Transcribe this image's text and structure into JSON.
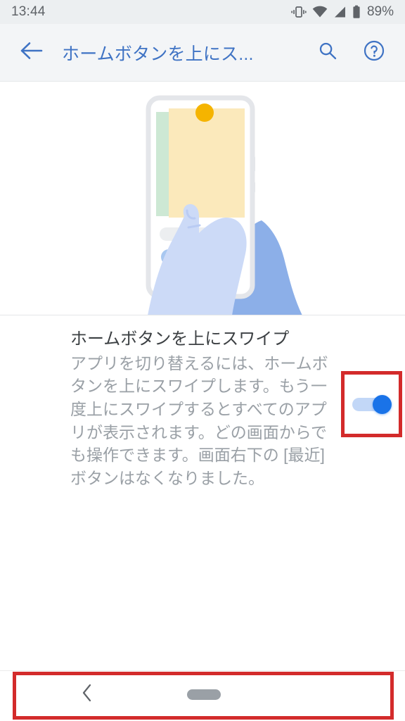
{
  "status_bar": {
    "time": "13:44",
    "battery_percent": "89%",
    "icons": [
      "vibrate-icon",
      "wifi-icon",
      "cell-signal-icon",
      "battery-icon"
    ]
  },
  "app_bar": {
    "back_label": "back-arrow",
    "title": "ホームボタンを上にス...",
    "search_label": "search-icon",
    "help_label": "help-icon",
    "title_color": "#3f73c4"
  },
  "illustration": {
    "name": "swipe-up-home-button-illustration",
    "phone_screen_colors": {
      "card_back": "#cde8d4",
      "card_front": "#fbe9bb",
      "dot": "#f5b400",
      "hand": "#ccdaf7",
      "sleeve": "#8cafe8",
      "home_pill": "#1a73e8"
    },
    "app_dots": [
      "#a8c7f0",
      "#b7ddb4",
      "#f8d77e",
      "#f3a9a0"
    ]
  },
  "setting": {
    "title": "ホームボタンを上にスワイプ",
    "description": "アプリを切り替えるには、ホームボタンを上にスワイプします。もう一度上にスワイプするとすべてのアプリが表示されます。どの画面からでも操作できます。画面右下の [最近] ボタンはなくなりました。",
    "toggle": {
      "name": "swipe-up-home-button-switch",
      "state": "on",
      "track_color": "#c2d7f7",
      "thumb_color": "#1a73e8"
    }
  },
  "annotations": {
    "highlight_color": "#d32b2b",
    "boxes": [
      "toggle-highlight-box",
      "navigation-bar-highlight-box"
    ]
  },
  "navigation_bar": {
    "back_label": "nav-back-chevron",
    "home_label": "nav-home-pill",
    "home_pill_color": "#9aa0a6"
  }
}
